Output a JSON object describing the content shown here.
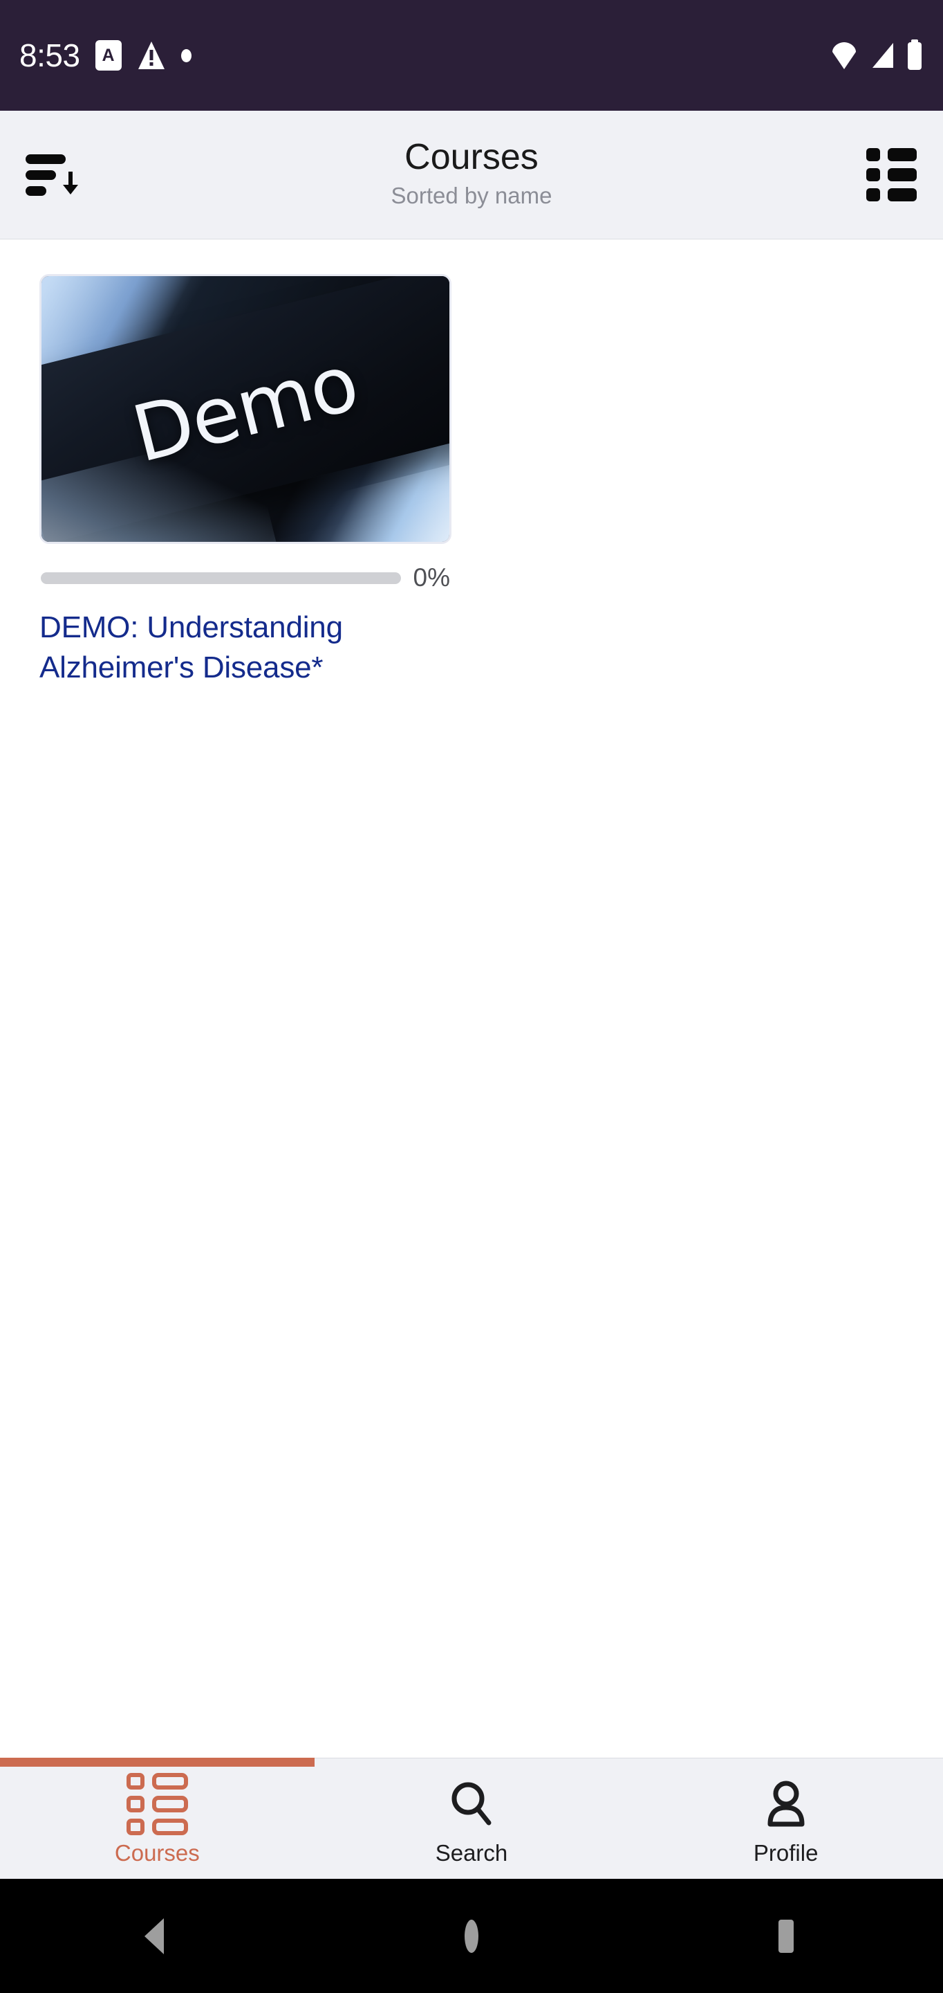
{
  "status_bar": {
    "time": "8:53",
    "left_icons": [
      {
        "name": "app-letter-a-icon",
        "glyph": "A"
      },
      {
        "name": "warning-triangle-icon",
        "glyph": "!"
      },
      {
        "name": "notification-dot-icon",
        "glyph": "•"
      }
    ],
    "right_icons": [
      {
        "name": "wifi-icon"
      },
      {
        "name": "cellular-signal-icon"
      },
      {
        "name": "battery-icon"
      }
    ],
    "background_color": "#2B1F38",
    "foreground_color": "#FFFFFF"
  },
  "app_bar": {
    "title": "Courses",
    "subtitle": "Sorted by name",
    "sort_button_name": "sort-descending",
    "view_toggle_name": "list-view",
    "background_color": "#F0F1F5"
  },
  "courses": [
    {
      "title": "DEMO: Understanding Alzheimer's Disease*",
      "thumbnail_text": "Demo",
      "progress_percent": 0,
      "progress_label": "0%",
      "title_color": "#142B8C"
    }
  ],
  "bottom_nav": {
    "active_index": 0,
    "accent_color": "#CC6B50",
    "items": [
      {
        "label": "Courses",
        "icon": "courses-list-icon"
      },
      {
        "label": "Search",
        "icon": "search-icon"
      },
      {
        "label": "Profile",
        "icon": "profile-person-icon"
      }
    ]
  },
  "android_nav": {
    "buttons": [
      {
        "name": "back-button",
        "icon": "back-triangle-icon"
      },
      {
        "name": "home-button",
        "icon": "home-circle-icon"
      },
      {
        "name": "recents-button",
        "icon": "recents-square-icon"
      }
    ],
    "background_color": "#000000",
    "icon_color": "#9E9E9E"
  }
}
